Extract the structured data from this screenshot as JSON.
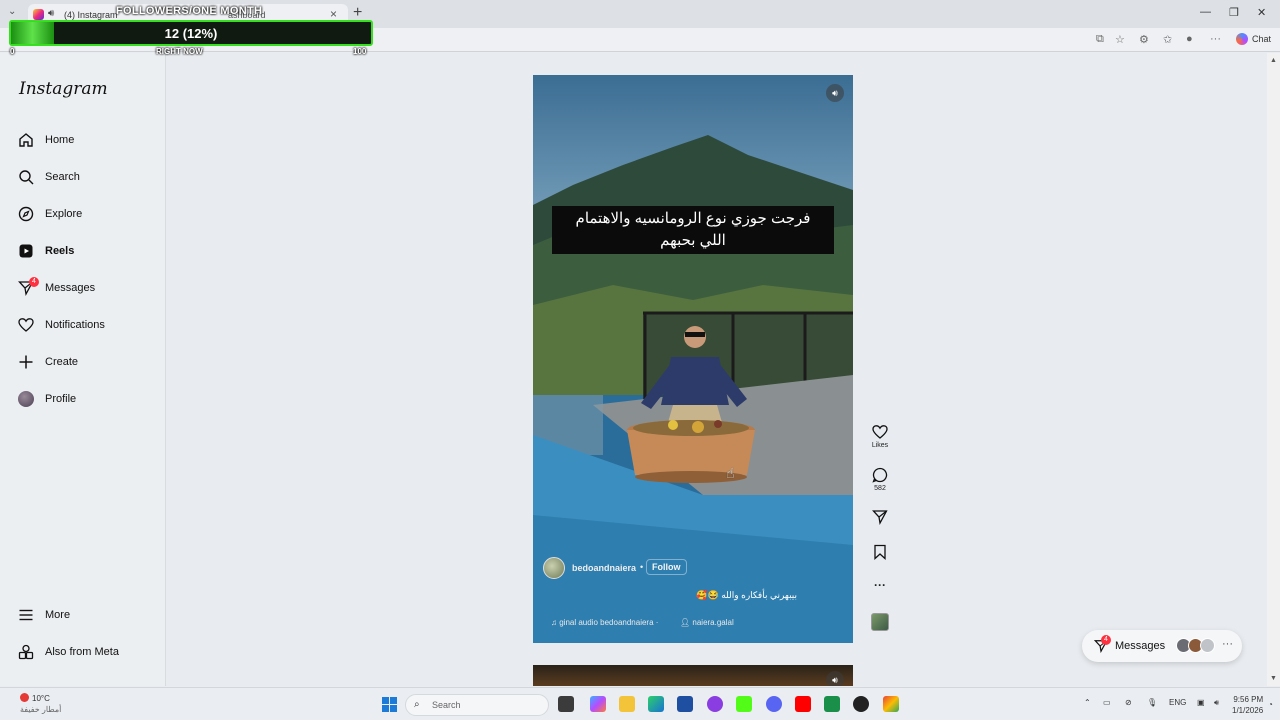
{
  "browser": {
    "tab_title": "(4) Instagram",
    "tab_title_2": "ashboard",
    "new_tab": "+",
    "chat_label": "Chat"
  },
  "overlay": {
    "title": "FOLLOWERS/ONE MONTH",
    "value_label": "12 (12%)",
    "progress_fraction": 0.12,
    "min_label": "0",
    "mid_label": "RIGHT NOW",
    "max_label": "100"
  },
  "instagram": {
    "logo": "Instagram",
    "nav": [
      {
        "label": "Home",
        "icon": "home-icon"
      },
      {
        "label": "Search",
        "icon": "search-icon"
      },
      {
        "label": "Explore",
        "icon": "explore-icon"
      },
      {
        "label": "Reels",
        "icon": "reels-icon"
      },
      {
        "label": "Messages",
        "icon": "messages-icon",
        "badge": "4"
      },
      {
        "label": "Notifications",
        "icon": "heart-icon"
      },
      {
        "label": "Create",
        "icon": "plus-icon"
      },
      {
        "label": "Profile",
        "icon": "avatar"
      }
    ],
    "bottom_nav": [
      {
        "label": "More",
        "icon": "menu-icon"
      },
      {
        "label": "Also from Meta",
        "icon": "meta-icon"
      }
    ]
  },
  "reel": {
    "caption_line1": "فرجت جوزي نوع الرومانسيه والاهتمام",
    "caption_line2": "اللي بحبهم",
    "username": "bedoandnaiera",
    "separator": "•",
    "follow": "Follow",
    "text": "بيبهرني بأفكاره والله 😂🥰",
    "audio": "♫ ginal audio  bedoandnaiera ·",
    "tag": "naiera.galal"
  },
  "actions": {
    "likes_label": "Likes",
    "comments_count": "582"
  },
  "messages_pill": {
    "label": "Messages",
    "badge": "4"
  },
  "taskbar": {
    "temp": "10°C",
    "weather_sub": "أمطار خفيفة",
    "search_placeholder": "Search",
    "lang": "ENG",
    "time": "9:56 PM",
    "date": "1/1/2026"
  }
}
